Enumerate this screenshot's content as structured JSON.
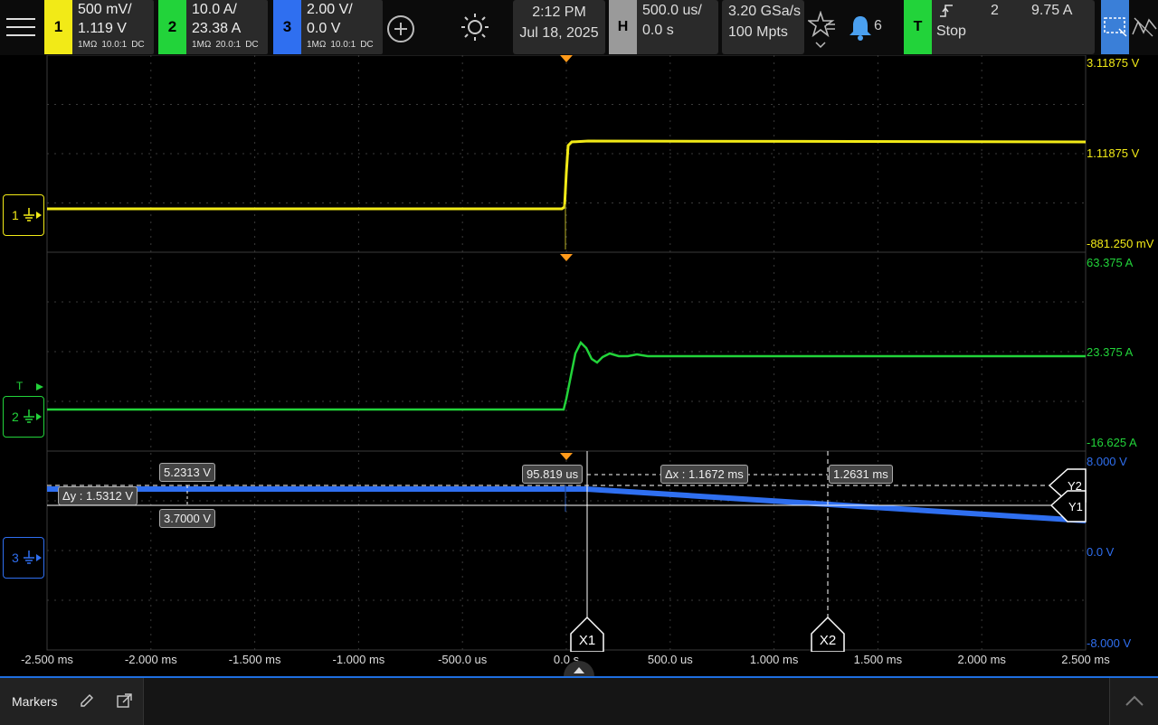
{
  "channels": [
    {
      "num": "1",
      "scale": "500 mV/",
      "offset": "1.119 V",
      "imp": "1MΩ",
      "probe": "10.0:1",
      "coupling": "DC",
      "color": "#f2ea17"
    },
    {
      "num": "2",
      "scale": "10.0 A/",
      "offset": "23.38 A",
      "imp": "1MΩ",
      "probe": "20.0:1",
      "coupling": "DC",
      "color": "#22d33a"
    },
    {
      "num": "3",
      "scale": "2.00 V/",
      "offset": "0.0 V",
      "imp": "1MΩ",
      "probe": "10.0:1",
      "coupling": "DC",
      "color": "#2f6ff0"
    }
  ],
  "datetime": {
    "time": "2:12 PM",
    "date": "Jul 18, 2025"
  },
  "horizontal": {
    "label": "H",
    "scale": "500.0 us/",
    "position": "0.0 s"
  },
  "acquisition": {
    "rate": "3.20 GSa/s",
    "depth": "100 Mpts"
  },
  "notifications": {
    "count": "6"
  },
  "trigger": {
    "label": "T",
    "source": "2",
    "level": "9.75 A",
    "state": "Stop"
  },
  "right_scales": {
    "ch1_top": "3.11875 V",
    "ch1_mid": "1.11875 V",
    "ch1_bot": "-881.250 mV",
    "ch2_top": "63.375 A",
    "ch2_mid": "23.375 A",
    "ch2_bot": "-16.625 A",
    "ch3_top": "8.000 V",
    "ch3_mid": "0.0 V",
    "ch3_bot": "-8.000 V"
  },
  "time_ticks": [
    "-2.500 ms",
    "-2.000 ms",
    "-1.500 ms",
    "-1.000 ms",
    "-500.0 us",
    "0.0 s",
    "500.0 us",
    "1.000 ms",
    "1.500 ms",
    "2.000 ms",
    "2.500 ms"
  ],
  "markers": {
    "y2_value": "5.2313 V",
    "y1_value": "3.7000 V",
    "dy": "Δy : 1.5312 V",
    "x1_value": "95.819 us",
    "dx": "Δx : 1.1672 ms",
    "x2_value": "1.2631 ms",
    "x1_label": "X1",
    "x2_label": "X2",
    "y1_label": "Y1",
    "y2_label": "Y2"
  },
  "ground_labels": {
    "ch1": "1",
    "ch2": "2",
    "ch3": "3",
    "trig": "T"
  },
  "bottom": {
    "tab": "Markers"
  },
  "colors": {
    "ch1": "#f2ea17",
    "ch2": "#22d33a",
    "ch3": "#2f6ff0",
    "trigger": "#ff9a1a"
  }
}
